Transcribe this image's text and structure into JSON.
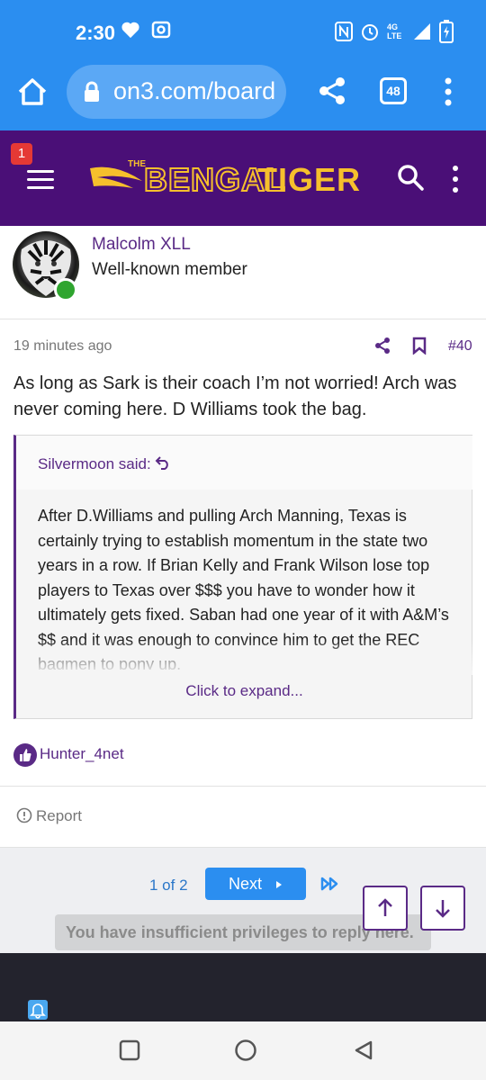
{
  "status_bar": {
    "time": "2:30",
    "network": "4G LTE"
  },
  "browser": {
    "url": "on3.com/board",
    "tab_count": "48"
  },
  "site": {
    "logo_the": "THE",
    "logo_bengal": "BENGAL",
    "logo_tiger": "TIGER",
    "notification_count": "1"
  },
  "post": {
    "username": "Malcolm XLL",
    "user_title": "Well-known member",
    "time": "19 minutes ago",
    "number": "#40",
    "body": "As long as Sark is their coach I’m not worried! Arch was never coming here. D Williams took the bag.",
    "quote": {
      "author": "Silvermoon said:",
      "text": "After D.Williams and pulling Arch Manning, Texas is certainly trying to establish momentum in the state two years in a row. If Brian Kelly and Frank Wilson lose top players to Texas over $$$ you have to wonder how it ultimately gets fixed. Saban had one year of it with A&M’s $$ and it was enough to convince him to get the REC bagmen to pony up.",
      "expand_label": "Click to expand..."
    },
    "reactions": "Hunter_4net",
    "report_label": "Report"
  },
  "pagination": {
    "info": "1 of 2",
    "next_label": "Next"
  },
  "notice": "You have insufficient privileges to reply here."
}
